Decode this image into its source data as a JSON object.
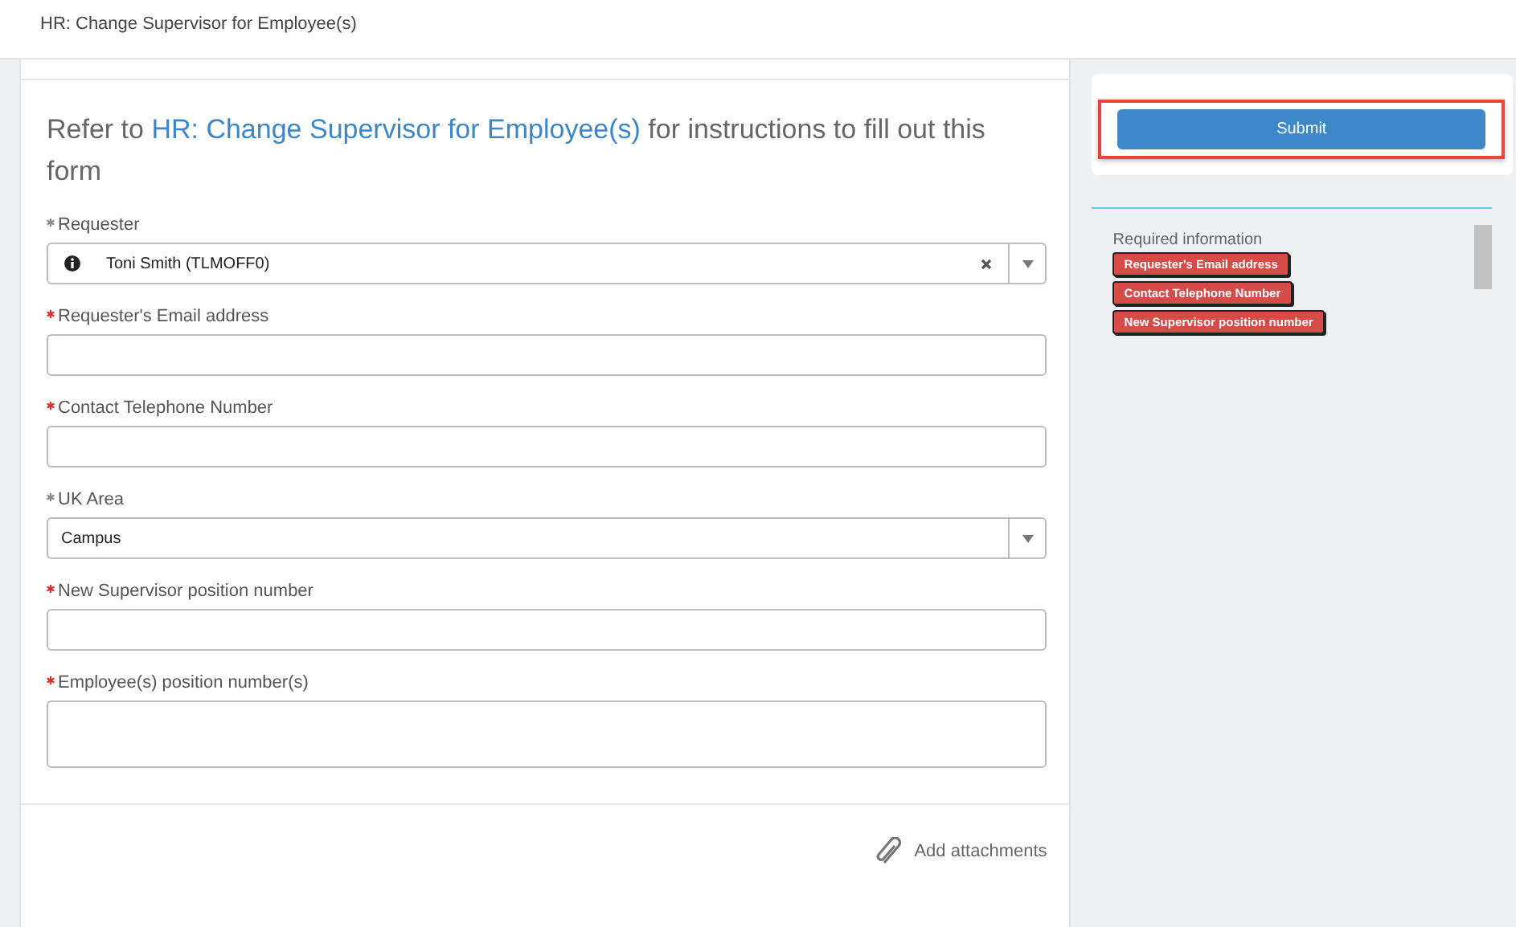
{
  "header": {
    "title": "HR: Change Supervisor for Employee(s)"
  },
  "form": {
    "intro_before": "Refer to ",
    "intro_link": "HR: Change Supervisor for Employee(s)",
    "intro_after": " for instructions to fill out this form",
    "fields": [
      {
        "kind": "reference",
        "label": "Requester",
        "missing": false,
        "value": "Toni Smith (TLMOFF0)"
      },
      {
        "kind": "text",
        "label": "Requester's Email address",
        "missing": true
      },
      {
        "kind": "text",
        "label": "Contact Telephone Number",
        "missing": true
      },
      {
        "kind": "choice",
        "label": "UK Area",
        "missing": false,
        "value": "Campus"
      },
      {
        "kind": "text",
        "label": "New Supervisor position number",
        "missing": true
      },
      {
        "kind": "textarea",
        "label": "Employee(s) position number(s)",
        "missing": true
      }
    ],
    "attachments": "Add attachments"
  },
  "sidebar": {
    "submit": "Submit",
    "required_title": "Required information",
    "required_items": [
      "Requester's Email address",
      "Contact Telephone Number",
      "New Supervisor position number"
    ]
  }
}
